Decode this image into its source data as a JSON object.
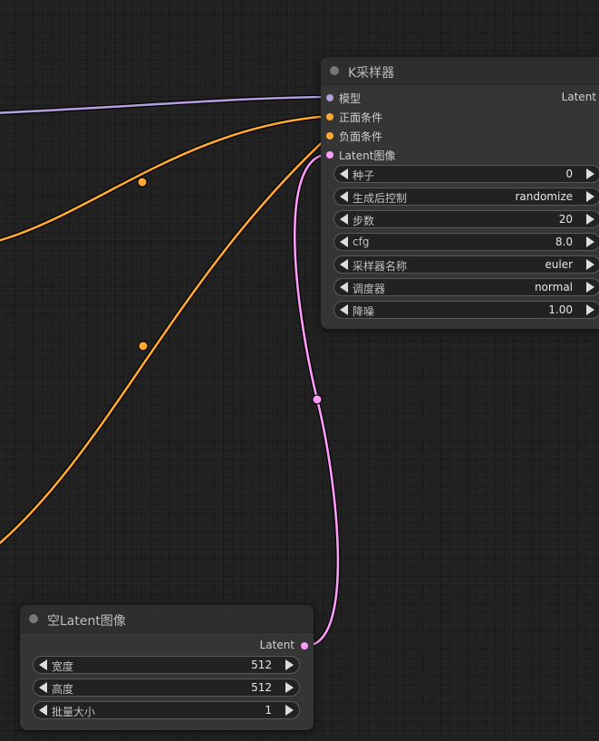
{
  "colors": {
    "model": "#b39ddb",
    "conditioning": "#ffa931",
    "latent": "#ff9cf9"
  },
  "ksampler": {
    "title": "K采样器",
    "inputs": [
      {
        "label": "模型",
        "type": "model"
      },
      {
        "label": "正面条件",
        "type": "conditioning"
      },
      {
        "label": "负面条件",
        "type": "conditioning"
      },
      {
        "label": "Latent图像",
        "type": "latent"
      }
    ],
    "output": {
      "label": "Latent"
    },
    "widgets": [
      {
        "label": "种子",
        "value": "0"
      },
      {
        "label": "生成后控制",
        "value": "randomize"
      },
      {
        "label": "步数",
        "value": "20"
      },
      {
        "label": "cfg",
        "value": "8.0"
      },
      {
        "label": "采样器名称",
        "value": "euler"
      },
      {
        "label": "调度器",
        "value": "normal"
      },
      {
        "label": "降噪",
        "value": "1.00"
      }
    ]
  },
  "empty_latent": {
    "title": "空Latent图像",
    "output": {
      "label": "Latent"
    },
    "widgets": [
      {
        "label": "宽度",
        "value": "512"
      },
      {
        "label": "高度",
        "value": "512"
      },
      {
        "label": "批量大小",
        "value": "1"
      }
    ]
  }
}
